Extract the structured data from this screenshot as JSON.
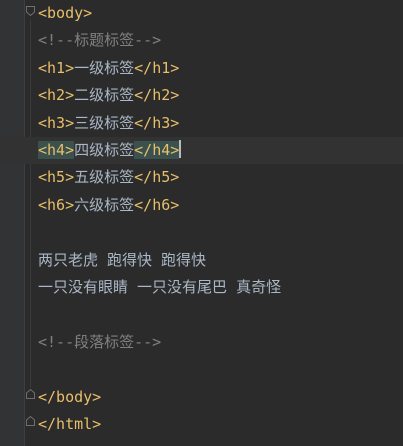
{
  "editor": {
    "lines": [
      {
        "open": "<body>",
        "text": "",
        "close": ""
      },
      {
        "comment": "<!--标题标签-->"
      },
      {
        "open": "<h1>",
        "text": "一级标签",
        "close": "</h1>"
      },
      {
        "open": "<h2>",
        "text": "二级标签",
        "close": "</h2>"
      },
      {
        "open": "<h3>",
        "text": "三级标签",
        "close": "</h3>"
      },
      {
        "open": "<h4>",
        "text": "四级标签",
        "close": "</h4>"
      },
      {
        "open": "<h5>",
        "text": "五级标签",
        "close": "</h5>"
      },
      {
        "open": "<h6>",
        "text": "六级标签",
        "close": "</h6>"
      },
      {},
      {
        "plain": "两只老虎 跑得快 跑得快"
      },
      {
        "plain": "一只没有眼睛 一只没有尾巴 真奇怪"
      },
      {},
      {
        "comment": "<!--段落标签-->"
      },
      {},
      {
        "open": "</body>",
        "text": "",
        "close": ""
      },
      {
        "open": "</html>",
        "text": "",
        "close": ""
      }
    ]
  },
  "colors": {
    "background": "#2b2b2b",
    "tag": "#e8bf6a",
    "comment": "#808080",
    "text": "#a9b7c6",
    "current_line": "#323232",
    "tag_match_highlight": "#3b514d"
  }
}
